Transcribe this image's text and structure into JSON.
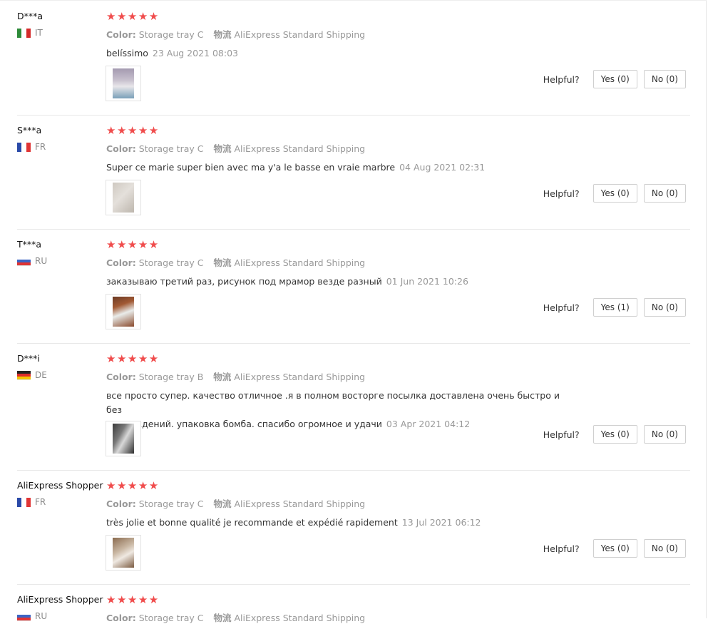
{
  "helpful_label": "Helpful?",
  "color_key": "Color:",
  "ship_key": "物流",
  "reviews": [
    {
      "user": "D***a",
      "country": "IT",
      "flag": [
        "#2e8b3a",
        "#ffffff",
        "#d42a2a"
      ],
      "flag_dir": "v",
      "stars": "★★★★★",
      "color": "Storage tray C",
      "shipping": "AliExpress Standard Shipping",
      "text": "belíssimo",
      "date": "23 Aug 2021 08:03",
      "yes": "Yes (0)",
      "no": "No (0)",
      "photo": "photo-1"
    },
    {
      "user": "S***a",
      "country": "FR",
      "flag": [
        "#2a4aa8",
        "#ffffff",
        "#e03434"
      ],
      "flag_dir": "v",
      "stars": "★★★★★",
      "color": "Storage tray C",
      "shipping": "AliExpress Standard Shipping",
      "text": "Super ce marie super bien avec ma y'a le basse en vraie marbre",
      "date": "04 Aug 2021 02:31",
      "yes": "Yes (0)",
      "no": "No (0)",
      "photo": "photo-2"
    },
    {
      "user": "T***a",
      "country": "RU",
      "flag": [
        "#ffffff",
        "#3b64c4",
        "#e03434"
      ],
      "flag_dir": "h",
      "stars": "★★★★★",
      "color": "Storage tray C",
      "shipping": "AliExpress Standard Shipping",
      "text": "заказываю третий раз, рисунок под мрамор везде разный",
      "date": "01 Jun 2021 10:26",
      "yes": "Yes (1)",
      "no": "No (0)",
      "photo": "photo-3"
    },
    {
      "user": "D***i",
      "country": "DE",
      "flag": [
        "#222222",
        "#dd2b2b",
        "#f2c400"
      ],
      "flag_dir": "h",
      "stars": "★★★★★",
      "color": "Storage tray B",
      "shipping": "AliExpress Standard Shipping",
      "text_lines": [
        "все просто супер. качество отличное .я в полном восторге посылка доставлена очень быстро и без",
        "повреждений. упаковка бомба. спасибо огромное и удачи"
      ],
      "date": "03 Apr 2021 04:12",
      "yes": "Yes (0)",
      "no": "No (0)",
      "photo": "photo-4"
    },
    {
      "user": "AliExpress Shopper",
      "country": "FR",
      "flag": [
        "#2a4aa8",
        "#ffffff",
        "#e03434"
      ],
      "flag_dir": "v",
      "stars": "★★★★★",
      "color": "Storage tray C",
      "shipping": "AliExpress Standard Shipping",
      "text": "très jolie et bonne qualité je recommande et expédié rapidement",
      "date": "13 Jul 2021 06:12",
      "yes": "Yes (0)",
      "no": "No (0)",
      "photo": "photo-5"
    },
    {
      "user": "AliExpress Shopper",
      "country": "RU",
      "flag": [
        "#ffffff",
        "#3b64c4",
        "#e03434"
      ],
      "flag_dir": "h",
      "stars": "★★★★★",
      "color": "Storage tray C",
      "shipping": "AliExpress Standard Shipping"
    }
  ]
}
